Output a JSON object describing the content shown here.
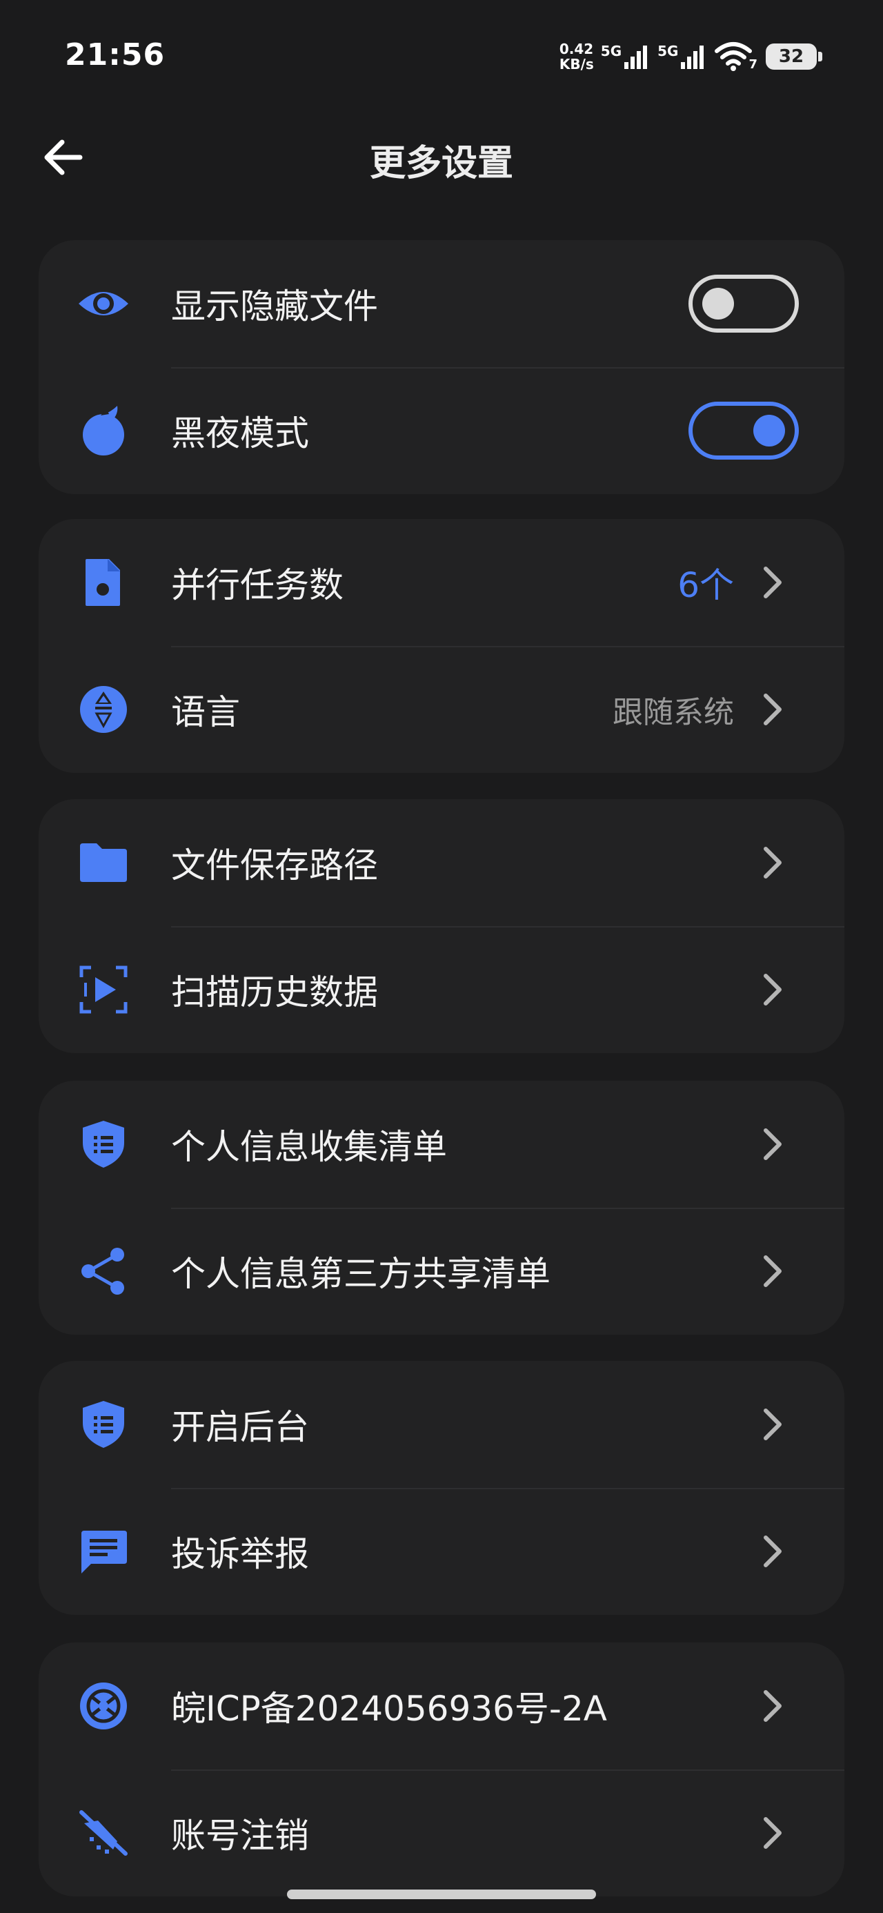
{
  "status": {
    "time": "21:56",
    "net_speed_value": "0.42",
    "net_speed_unit": "KB/s",
    "sim1_label": "5G",
    "sim2_label": "5G",
    "wifi_label": "7",
    "battery": "32"
  },
  "header": {
    "title": "更多设置"
  },
  "groups": [
    {
      "items": [
        {
          "label": "显示隐藏文件",
          "toggle": false,
          "icon": "eye-icon"
        },
        {
          "label": "黑夜模式",
          "toggle": true,
          "icon": "night-mode-icon"
        }
      ]
    },
    {
      "items": [
        {
          "label": "并行任务数",
          "value": "6个",
          "icon": "file-icon"
        },
        {
          "label": "语言",
          "value": "跟随系统",
          "icon": "language-icon"
        }
      ]
    },
    {
      "items": [
        {
          "label": "文件保存路径",
          "icon": "folder-icon"
        },
        {
          "label": "扫描历史数据",
          "icon": "scan-icon"
        }
      ]
    },
    {
      "items": [
        {
          "label": "个人信息收集清单",
          "icon": "shield-list-icon"
        },
        {
          "label": "个人信息第三方共享清单",
          "icon": "share-icon"
        }
      ]
    },
    {
      "items": [
        {
          "label": "开启后台",
          "icon": "shield-list-icon"
        },
        {
          "label": "投诉举报",
          "icon": "message-icon"
        }
      ]
    },
    {
      "items": [
        {
          "label": "皖ICP备2024056936号-2A",
          "icon": "icp-icon"
        },
        {
          "label": "账号注销",
          "icon": "account-cancel-icon"
        }
      ]
    }
  ],
  "colors": {
    "accent": "#4d7ff5",
    "background": "#1b1b1c",
    "card": "#222223"
  }
}
